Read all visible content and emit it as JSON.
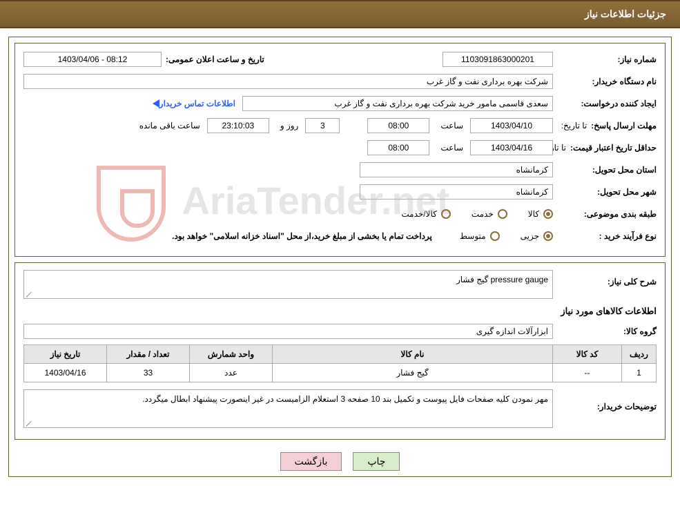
{
  "header": {
    "title": "جزئیات اطلاعات نیاز"
  },
  "labels": {
    "need_no": "شماره نیاز:",
    "announce": "تاریخ و ساعت اعلان عمومی:",
    "buyer_org": "نام دستگاه خریدار:",
    "requester": "ایجاد کننده درخواست:",
    "contact_link": "اطلاعات تماس خریدار",
    "reply_deadline": "مهلت ارسال پاسخ:",
    "until_date": "تا تاریخ:",
    "hour": "ساعت",
    "days_and": "روز و",
    "hours_left": "ساعت باقی مانده",
    "min_valid": "حداقل تاریخ اعتبار قیمت:",
    "province": "استان محل تحویل:",
    "city": "شهر محل تحویل:",
    "subject_class": "طبقه بندی موضوعی:",
    "goods": "کالا",
    "service": "خدمت",
    "goods_service": "کالا/خدمت",
    "purchase_type": "نوع فرآیند خرید :",
    "partial": "جزیی",
    "medium": "متوسط",
    "purchase_note": "پرداخت تمام یا بخشی از مبلغ خرید،از محل \"اسناد خزانه اسلامی\" خواهد بود.",
    "need_desc": "شرح کلی نیاز:",
    "items_info": "اطلاعات کالاهای مورد نیاز",
    "goods_group": "گروه کالا:",
    "buyer_notes": "توضیحات خریدار:"
  },
  "fields": {
    "need_no": "1103091863000201",
    "announce": "1403/04/06 - 08:12",
    "buyer_org": "شرکت بهره برداری نفت و گاز غرب",
    "requester": "سعدی قاسمی مامور خرید شرکت بهره برداری نفت و گاز غرب",
    "reply_date": "1403/04/10",
    "reply_time": "08:00",
    "days_left": "3",
    "countdown": "23:10:03",
    "valid_date": "1403/04/16",
    "valid_time": "08:00",
    "province": "کرمانشاه",
    "city": "کرمانشاه",
    "need_desc": "pressure gauge  گیج فشار",
    "goods_group": "ابزارآلات اندازه گیری",
    "buyer_notes": "مهر نمودن کلیه صفحات فایل پیوست و تکمیل بند 10 صفحه 3 استعلام الزامیست در غیر اینصورت پیشنهاد ابطال میگردد."
  },
  "subject_class_selected": "goods",
  "purchase_type_selected": "partial",
  "table": {
    "headers": {
      "row": "ردیف",
      "code": "کد کالا",
      "name": "نام کالا",
      "unit": "واحد شمارش",
      "qty": "تعداد / مقدار",
      "date": "تاریخ نیاز"
    },
    "rows": [
      {
        "row": "1",
        "code": "--",
        "name": "گیج فشار",
        "unit": "عدد",
        "qty": "33",
        "date": "1403/04/16"
      }
    ]
  },
  "buttons": {
    "print": "چاپ",
    "back": "بازگشت"
  },
  "watermark": "AriaTender.net"
}
